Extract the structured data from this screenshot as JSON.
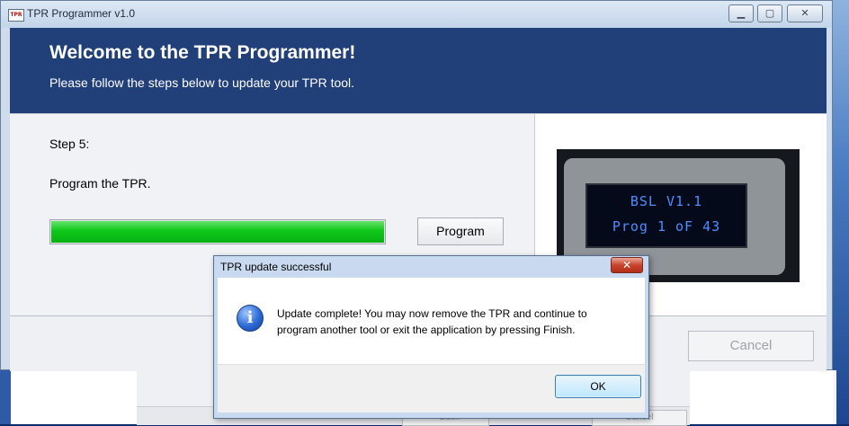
{
  "window": {
    "title": "TPR Programmer v1.0",
    "icon_text": "TPR"
  },
  "header": {
    "title": "Welcome to the TPR Programmer!",
    "subtitle": "Please follow the steps below to update your TPR tool."
  },
  "step": {
    "label": "Step 5:",
    "description": "Program the TPR.",
    "progress_percent": 100,
    "program_button": "Program"
  },
  "device_display": {
    "line1": "BSL V1.1",
    "line2": "Prog 1 oF 43"
  },
  "footer": {
    "cancel_button": "Cancel"
  },
  "dialog": {
    "title": "TPR update successful",
    "close_label": "✕",
    "message_line1": "Update complete! You may now remove the TPR and continue to",
    "message_line2": "program another tool or exit the application by pressing Finish.",
    "ok_button": "OK",
    "icon": "info-icon"
  },
  "background_window": {
    "back_button": "< Back",
    "cancel_button": "Cancel"
  }
}
